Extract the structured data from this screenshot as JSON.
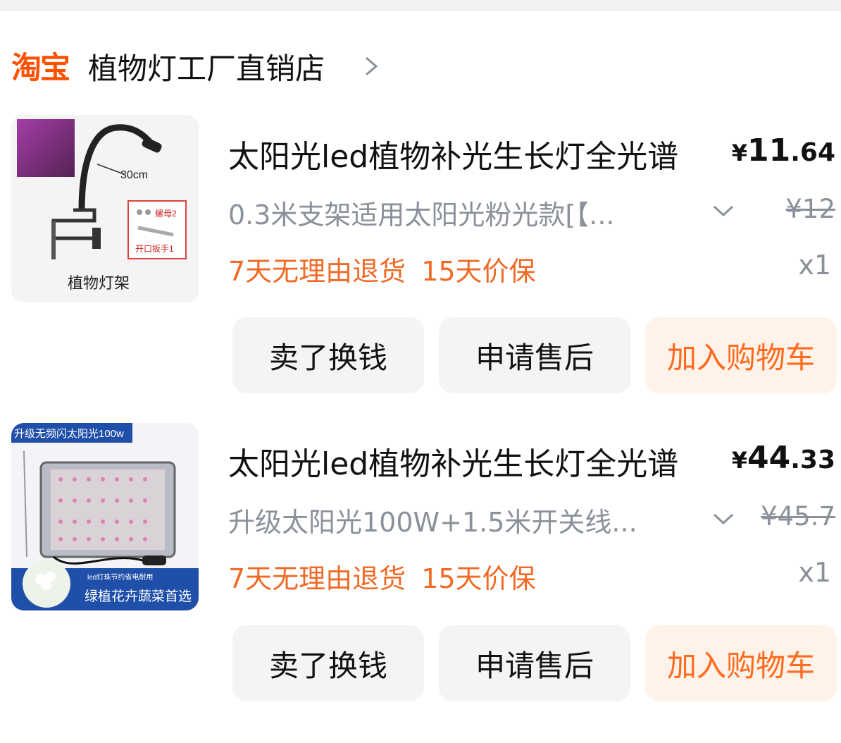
{
  "shop": {
    "logo_text": "淘宝",
    "name": "植物灯工厂直销店"
  },
  "orders": [
    {
      "title": "太阳光led植物补光生长灯全光谱",
      "price_currency": "¥",
      "price_int": "11",
      "price_dec": ".64",
      "spec": "0.3米支架适用太阳光粉光款[【...",
      "original_price": "¥12",
      "tags": [
        "7天无理由退货",
        "15天价保"
      ],
      "quantity": "x1",
      "image_labels": {
        "length": "30cm",
        "nut": "螺母2",
        "wrench": "开口扳手1",
        "caption": "植物灯架"
      },
      "buttons": {
        "sell": "卖了换钱",
        "after_sale": "申请售后",
        "add_cart": "加入购物车"
      }
    },
    {
      "title": "太阳光led植物补光生长灯全光谱",
      "price_currency": "¥",
      "price_int": "44",
      "price_dec": ".33",
      "spec": "升级太阳光100W+1.5米开关线...",
      "original_price": "¥45.7",
      "tags": [
        "7天无理由退货",
        "15天价保"
      ],
      "quantity": "x1",
      "image_labels": {
        "banner": "升级无频闪太阳光100w",
        "small": "led灯珠节约省电耐用",
        "caption": "绿植花卉蔬菜首选"
      },
      "buttons": {
        "sell": "卖了换钱",
        "after_sale": "申请售后",
        "add_cart": "加入购物车"
      }
    }
  ],
  "colors": {
    "accent": "#ff5000",
    "tag": "#f06a25",
    "muted": "#8b919a"
  },
  "icons": [
    "chevron-right-icon",
    "chevron-down-icon"
  ]
}
